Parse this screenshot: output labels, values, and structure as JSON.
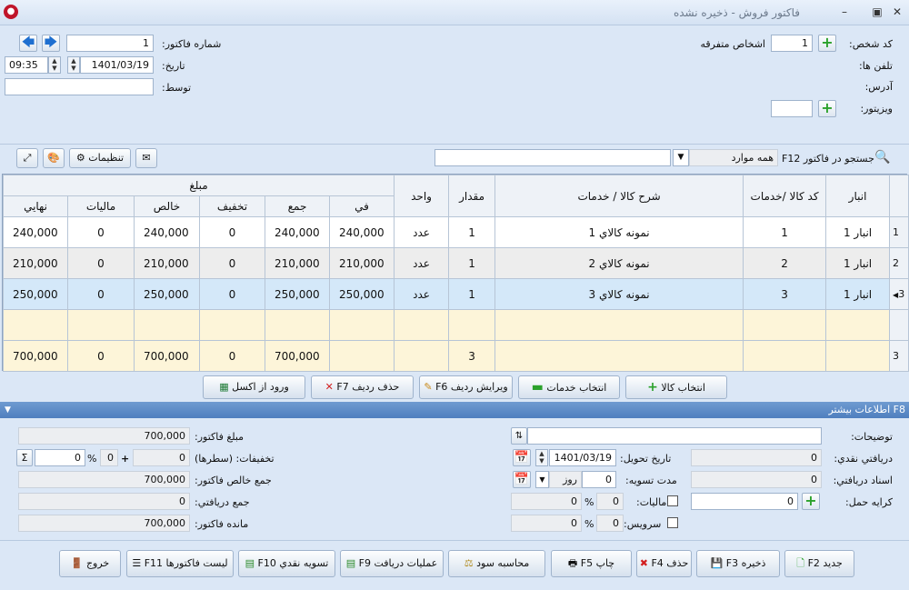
{
  "window": {
    "title": "فاكتور فروش - ذخيره نشده",
    "min": "–",
    "max": "▣",
    "close": "✕"
  },
  "header": {
    "person_code_label": "كد شخص:",
    "person_code": "1",
    "person_name": "اشخاص متفرقه",
    "phones_label": "تلفن ها:",
    "address_label": "آدرس:",
    "visitor_label": "ويزيتور:",
    "visitor_code": "",
    "invoice_no_label": "شماره فاكتور:",
    "invoice_no": "1",
    "date_label": "تاريخ:",
    "date": "1401/03/19",
    "time": "09:35",
    "by_label": "توسط:",
    "by_value": ""
  },
  "toolbar": {
    "search_label": "جستجو در فاكتور F12",
    "search_scope": "همه موارد",
    "search_value": "",
    "settings_label": "تنظيمات"
  },
  "grid": {
    "headers": {
      "warehouse": "انبار",
      "code": "كد كالا /خدمات",
      "desc": "شرح كالا / خدمات",
      "qty": "مقدار",
      "unit": "واحد",
      "amount_group": "مبلغ",
      "unit_price": "في",
      "sum": "جمع",
      "discount": "تخفيف",
      "net": "خالص",
      "tax": "ماليات",
      "final": "نهايي"
    },
    "rows": [
      {
        "num": "1",
        "warehouse": "انبار 1",
        "code": "1",
        "desc": "نمونه كالاي 1",
        "qty": "1",
        "unit": "عدد",
        "unit_price": "240,000",
        "sum": "240,000",
        "discount": "0",
        "net": "240,000",
        "tax": "0",
        "final": "240,000"
      },
      {
        "num": "2",
        "warehouse": "انبار 1",
        "code": "2",
        "desc": "نمونه كالاي 2",
        "qty": "1",
        "unit": "عدد",
        "unit_price": "210,000",
        "sum": "210,000",
        "discount": "0",
        "net": "210,000",
        "tax": "0",
        "final": "210,000"
      },
      {
        "num": "3",
        "warehouse": "انبار 1",
        "code": "3",
        "desc": "نمونه كالاي 3",
        "qty": "1",
        "unit": "عدد",
        "unit_price": "250,000",
        "sum": "250,000",
        "discount": "0",
        "net": "250,000",
        "tax": "0",
        "final": "250,000"
      }
    ],
    "totals": {
      "num": "3",
      "qty": "3",
      "sum": "700,000",
      "discount": "0",
      "net": "700,000",
      "tax": "0",
      "final": "700,000"
    }
  },
  "actions": {
    "select_goods": "انتخاب كالا",
    "select_services": "انتخاب خدمات",
    "edit_row": "ويرايش رديف F6",
    "delete_row": "حذف رديف F7",
    "import_excel": "ورود از اكسل"
  },
  "more_info": {
    "title": "F8 اطلاعات بيشتر"
  },
  "details": {
    "notes_label": "توضيحات:",
    "notes": "",
    "cash_label": "دريافتي نقدي:",
    "cash": "0",
    "docs_label": "اسناد دريافتي:",
    "docs": "0",
    "freight_label": "كرايه حمل:",
    "freight": "0",
    "delivery_label": "تاريخ تحويل:",
    "delivery_date": "1401/03/19",
    "settle_label": "مدت تسويه:",
    "settle_value": "0",
    "settle_unit": "روز",
    "tax_label": "ماليات:",
    "tax_percent": "0",
    "tax_amount": "0",
    "service_label": "سرويس:",
    "service_percent": "0",
    "service_amount": "0",
    "percent_sign": "%",
    "invoice_amount_label": "مبلغ فاكتور:",
    "invoice_amount": "700,000",
    "discounts_label": "تخفيفات: (سطرها)",
    "discount_rows": "0",
    "discount_extra": "0",
    "discount_percent": "0",
    "net_total_label": "جمع خالص فاكتور:",
    "net_total": "700,000",
    "received_label": "جمع دريافتي:",
    "received": "0",
    "remaining_label": "مانده فاكتور:",
    "remaining": "700,000"
  },
  "footer": {
    "new": "جديد F2",
    "save": "ذخيره F3",
    "delete": "حذف F4",
    "print": "چاپ F5",
    "profit": "محاسبه سود",
    "receive_ops": "عمليات دريافت F9",
    "cash_settle": "تسويه نقدي F10",
    "invoice_list": "ليست فاكتورها F11",
    "exit": "خروج"
  }
}
